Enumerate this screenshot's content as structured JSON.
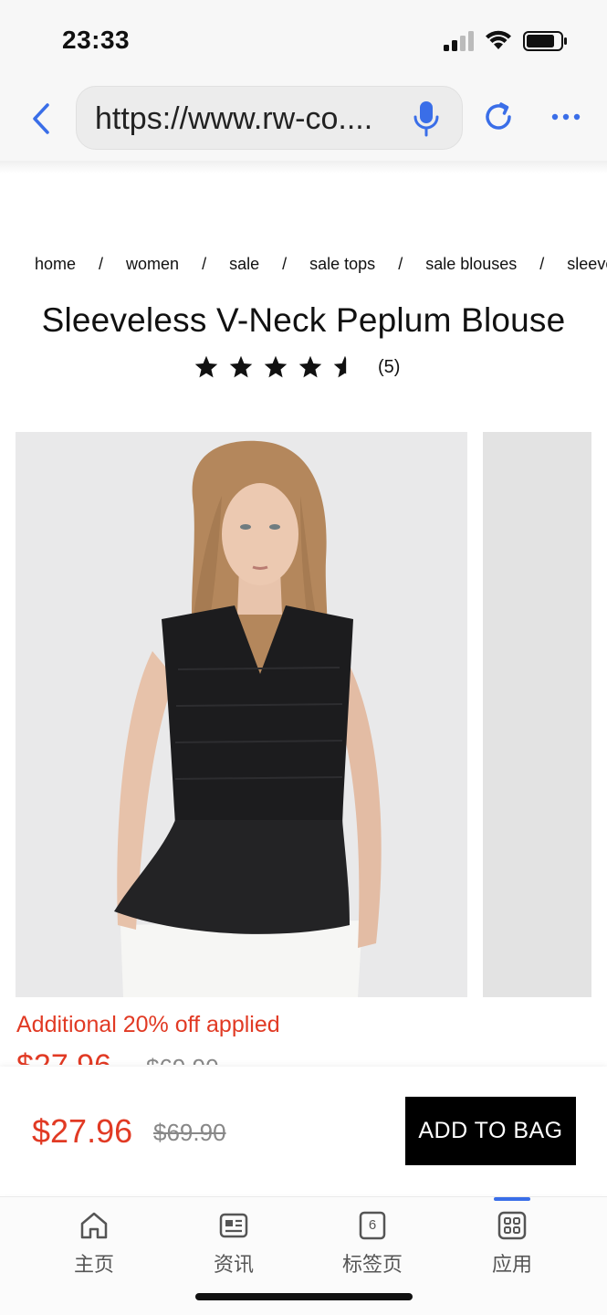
{
  "status_bar": {
    "time": "23:33"
  },
  "browser": {
    "url": "https://www.rw-co....",
    "icons": [
      "back-chevron-icon",
      "mic-icon",
      "reload-icon",
      "more-icon"
    ]
  },
  "breadcrumb": [
    "home",
    "women",
    "sale",
    "sale tops",
    "sale blouses",
    "sleevel"
  ],
  "breadcrumb_separator": "/",
  "product": {
    "title": "Sleeveless V-Neck Peplum Blouse",
    "rating": 4.5,
    "review_count": "(5)",
    "promo": "Additional 20% off applied",
    "price_peek": "$27.96",
    "orig_price_peek": "$69.90",
    "sale_price": "$27.96",
    "original_price": "$69.90",
    "add_to_bag": "ADD TO BAG"
  },
  "colors": {
    "sale_red": "#e13a24",
    "accent_blue": "#3a6ee8",
    "button_black": "#000000"
  },
  "tab_bar": {
    "tabs": [
      {
        "label": "主页",
        "icon": "home-icon"
      },
      {
        "label": "资讯",
        "icon": "news-icon"
      },
      {
        "label": "标签页",
        "icon": "tabs-icon",
        "badge": "6"
      },
      {
        "label": "应用",
        "icon": "apps-icon"
      }
    ],
    "active_index": 3
  }
}
